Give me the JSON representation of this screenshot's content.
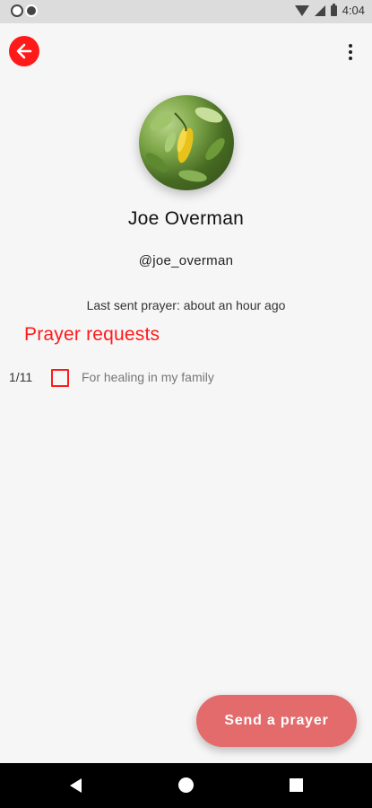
{
  "status_bar": {
    "time": "4:04",
    "icons": [
      "wifi-icon",
      "signal-icon",
      "battery-icon"
    ]
  },
  "app_bar": {
    "back_icon": "arrow-left-icon",
    "menu_icon": "more-vert-icon"
  },
  "profile": {
    "name": "Joe Overman",
    "handle": "@joe_overman",
    "last_sent": "Last sent prayer: about an hour ago"
  },
  "prayer_requests": {
    "title": "Prayer requests",
    "items": [
      {
        "count": "1/11",
        "text": "For healing in my family",
        "checked": false
      }
    ]
  },
  "fab": {
    "label": "Send a prayer"
  },
  "colors": {
    "accent": "#ff1a1a",
    "fab": "#e36b6b",
    "background": "#f6f6f6"
  }
}
